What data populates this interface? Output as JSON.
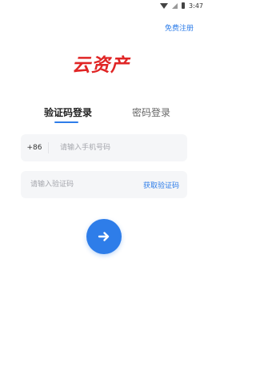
{
  "status_bar": {
    "time": "3:47"
  },
  "header": {
    "register_link": "免费注册"
  },
  "logo": {
    "text": "云资产"
  },
  "tabs": [
    {
      "label": "验证码登录",
      "active": true
    },
    {
      "label": "密码登录",
      "active": false
    }
  ],
  "phone_field": {
    "country_code": "+86",
    "placeholder": "请输入手机号码",
    "value": ""
  },
  "code_field": {
    "placeholder": "请输入验证码",
    "value": "",
    "get_code_label": "获取验证码"
  },
  "submit": {
    "icon": "arrow-right-icon"
  },
  "colors": {
    "accent": "#2e7de9",
    "brand_red": "#e02525",
    "field_bg": "#f5f6f8"
  }
}
